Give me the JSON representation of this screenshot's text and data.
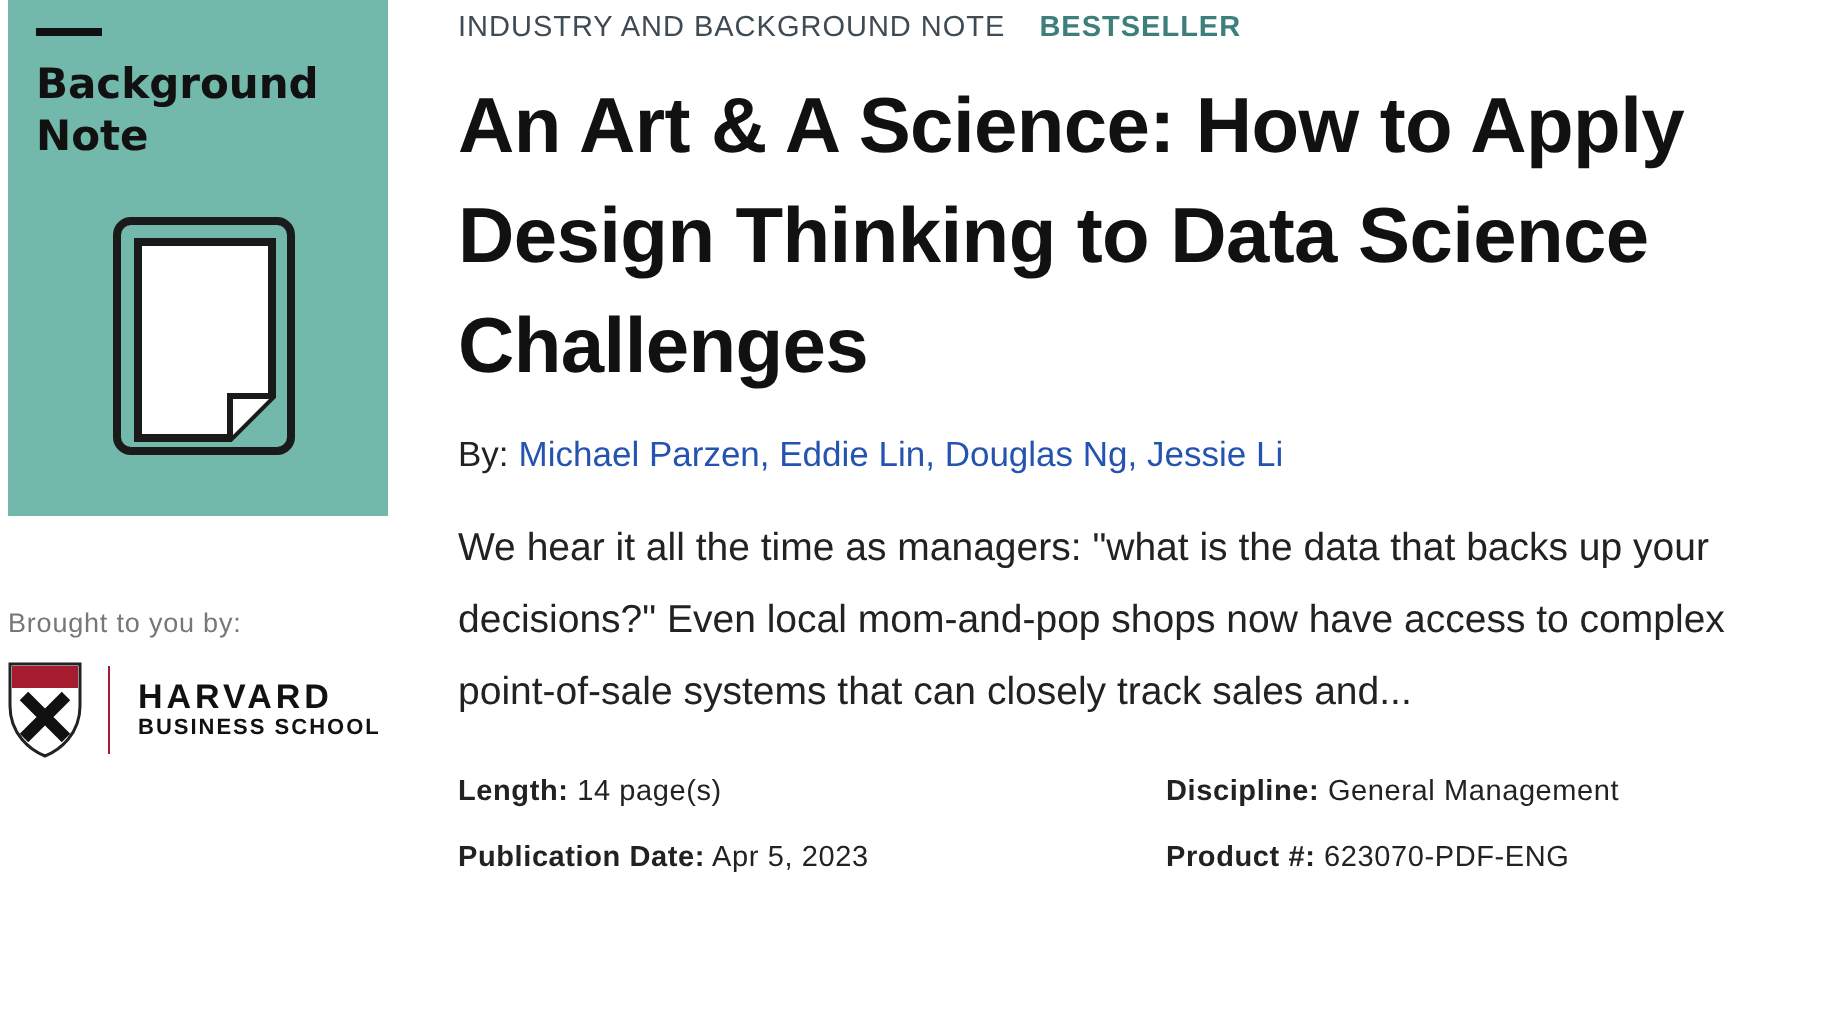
{
  "cover": {
    "title": "Background Note"
  },
  "brought_by": "Brought to you by:",
  "logo": {
    "line_1": "HARVARD",
    "line_2": "BUSINESS SCHOOL"
  },
  "category": "INDUSTRY AND BACKGROUND NOTE",
  "badge": "BESTSELLER",
  "title": "An Art & A Science: How to Apply Design Thinking to Data Science Challenges",
  "by_label": "By:",
  "authors": "Michael Parzen, Eddie Lin, Douglas Ng, Jessie Li",
  "description": "We hear it all the time as managers: \"what is the data that backs up your decisions?\" Even local mom-and-pop shops now have access to complex point-of-sale systems that can closely track sales and...",
  "details": [
    {
      "text": "**Length:** 14 page(s)"
    },
    {
      "text": "**Discipline:** General Management"
    },
    {
      "text": "**Publication Date:** Apr 5, 2023"
    },
    {
      "text": "**Product #:** 623070-PDF-ENG"
    }
  ]
}
